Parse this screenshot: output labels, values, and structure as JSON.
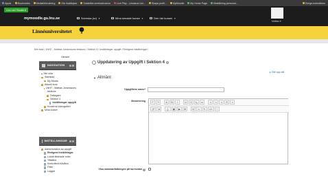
{
  "bookmarks": {
    "items": [
      {
        "label": "Appar",
        "icon": "apps-icon"
      },
      {
        "label": "Bookmarks",
        "icon": "star-icon"
      },
      {
        "label": "Mediaförbrukning",
        "icon": "folder-icon"
      },
      {
        "label": "Gör lisstänjsar",
        "icon": "folder-icon"
      },
      {
        "label": "Sokahitta ometoderacion",
        "icon": "folder-icon"
      },
      {
        "label": "Live Play - Linnaeus Uni...",
        "icon": "play-icon"
      },
      {
        "label": "Skapa profil...",
        "icon": "folder-icon"
      },
      {
        "label": "MyMoodle",
        "icon": "folder-icon"
      },
      {
        "label": "My Home Page",
        "icon": "page-icon"
      },
      {
        "label": "Beställning personal...",
        "icon": "page-icon"
      }
    ],
    "right": "Övriga bokmärken"
  },
  "topbar": {
    "badge": "Linu sel Student",
    "site": "mymoodle.gu.lnu.se",
    "nav": [
      {
        "label": "Svenska (sv)"
      },
      {
        "label": "Mina senaste kurser"
      },
      {
        "label": "Den här kursen"
      }
    ],
    "user": "Mattias ▾"
  },
  "brand": {
    "logo": "Linnéuniversitetet"
  },
  "breadcrumb": "Min sida  /  1NHT - Mattias Johanssons testkurs  /  Sektion 4  /  Inställningar uppgift  /  Redigera inställningar  /",
  "hide_blocks": "Vänster",
  "navigation": {
    "title": "NAVIGATION",
    "items": [
      {
        "label": "Min sida",
        "kind": "bullet"
      },
      {
        "label": "Startsida",
        "kind": "folder"
      },
      {
        "label": "My Media",
        "kind": "folder",
        "indent": 1
      },
      {
        "label": "Aktuell kurs",
        "kind": "folder"
      },
      {
        "label": "1NHT - Mattias Johanssons",
        "kind": "folder",
        "indent": 1
      },
      {
        "label": "testkurs",
        "kind": "text",
        "indent": 1
      },
      {
        "label": "Deltagare",
        "kind": "folder",
        "indent": 2
      },
      {
        "label": "Sektion 4",
        "kind": "folder",
        "indent": 2
      },
      {
        "label": "Inställningar uppgift",
        "kind": "doc",
        "indent": 3,
        "bold": true
      },
      {
        "label": "Kurserns videogalleri",
        "kind": "folder",
        "indent": 1
      },
      {
        "label": "Mina kurser",
        "kind": "folder"
      }
    ]
  },
  "settings": {
    "title": "INSTÄLLNINGAR",
    "items": [
      {
        "label": "Administration av uppgift",
        "kind": "folder"
      },
      {
        "label": "Redigera inställningar",
        "kind": "doc",
        "indent": 1,
        "bold": true
      },
      {
        "label": "Lokalt tilldelade roller",
        "kind": "doc",
        "indent": 1
      },
      {
        "label": "Tillstånd",
        "kind": "doc",
        "indent": 1
      },
      {
        "label": "Kontrollera tillstånd",
        "kind": "doc",
        "indent": 1
      },
      {
        "label": "Filter",
        "kind": "doc",
        "indent": 1
      },
      {
        "label": "Loggar",
        "kind": "doc",
        "indent": 1
      }
    ]
  },
  "main": {
    "title": "Uppdatering av Uppgift i Sektion 4",
    "expand_all": "Fäll upp allt",
    "section": "Allmänt",
    "name_label": "Uppgiftens namn",
    "name_value": "",
    "desc_label": "Beskrivning",
    "show_desc_label": "Visa sammanfattningen på kurssidan"
  },
  "editor": {
    "row1": [
      "↶",
      "↷",
      "A",
      "B",
      "I",
      "U",
      "S",
      "x₂",
      "x²",
      "≡",
      "≡",
      "≡",
      "¶",
      "≡"
    ],
    "row2": [
      "🔗",
      "⊘",
      "⚓",
      "▣",
      "▶",
      "⊞",
      "Ω",
      "☺",
      "✎",
      "</>",
      "⛶"
    ]
  }
}
